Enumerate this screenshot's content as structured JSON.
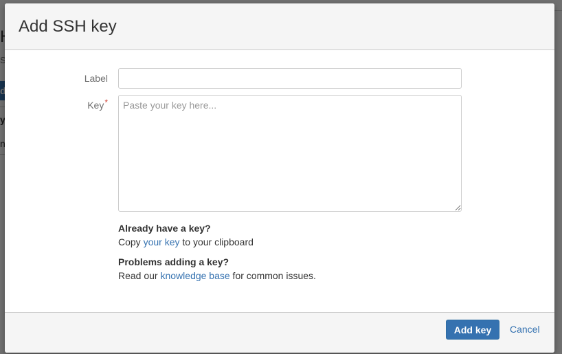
{
  "background": {
    "heading_fragment": "H",
    "subtext_fragment": "S",
    "button_fragment": "d",
    "column_fragment": "y",
    "row_fragment": "n"
  },
  "dialog": {
    "title": "Add SSH key",
    "fields": {
      "label": {
        "label": "Label",
        "value": "",
        "placeholder": ""
      },
      "key": {
        "label": "Key",
        "required_marker": "*",
        "value": "",
        "placeholder": "Paste your key here..."
      }
    },
    "help": {
      "existing_key": {
        "title": "Already have a key?",
        "prefix": "Copy ",
        "link": "your key",
        "suffix": " to your clipboard"
      },
      "problems": {
        "title": "Problems adding a key?",
        "prefix": "Read our ",
        "link": "knowledge base",
        "suffix": " for common issues."
      }
    },
    "footer": {
      "submit_label": "Add key",
      "cancel_label": "Cancel"
    }
  },
  "colors": {
    "primary": "#3572b0",
    "link": "#3572b0",
    "required": "#d04437",
    "header_bg": "#f5f5f5"
  }
}
